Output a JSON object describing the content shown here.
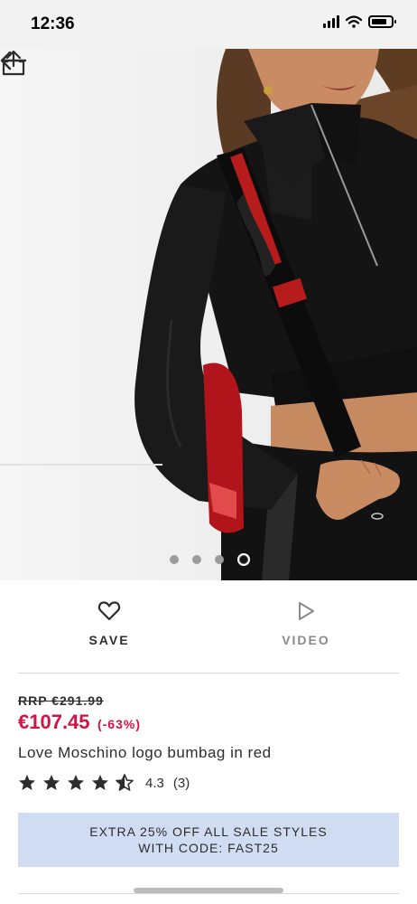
{
  "status_bar": {
    "time": "12:36"
  },
  "product_image": {
    "alt": "Model wearing black cropped jacket with red Love Moschino bumbag and chain strap",
    "pagination": {
      "total": 4,
      "current": 4
    }
  },
  "actions": {
    "save_label": "SAVE",
    "video_label": "VIDEO"
  },
  "pricing": {
    "rrp": "RRP €291.99",
    "price": "€107.45",
    "discount": "(-63%)",
    "accent_color": "#d01345"
  },
  "product": {
    "title": "Love Moschino logo bumbag in red",
    "rating": "4.3",
    "review_count": "(3)",
    "stars_out_of_5": 4.3
  },
  "promo": {
    "line1": "EXTRA 25% OFF ALL SALE STYLES",
    "line2": "WITH CODE: FAST25",
    "background": "#cfdcf2"
  },
  "icons": {
    "back": "back-arrow-icon",
    "share": "share-icon",
    "save": "heart-icon",
    "video": "play-icon",
    "star": "star-icon"
  }
}
